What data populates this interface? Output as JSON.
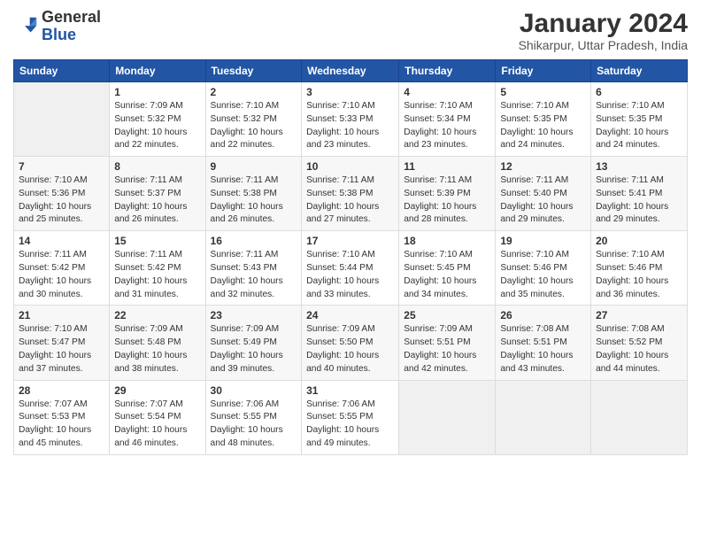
{
  "header": {
    "logo_general": "General",
    "logo_blue": "Blue",
    "title": "January 2024",
    "location": "Shikarpur, Uttar Pradesh, India"
  },
  "days_of_week": [
    "Sunday",
    "Monday",
    "Tuesday",
    "Wednesday",
    "Thursday",
    "Friday",
    "Saturday"
  ],
  "weeks": [
    [
      {
        "day": "",
        "info": ""
      },
      {
        "day": "1",
        "info": "Sunrise: 7:09 AM\nSunset: 5:32 PM\nDaylight: 10 hours\nand 22 minutes."
      },
      {
        "day": "2",
        "info": "Sunrise: 7:10 AM\nSunset: 5:32 PM\nDaylight: 10 hours\nand 22 minutes."
      },
      {
        "day": "3",
        "info": "Sunrise: 7:10 AM\nSunset: 5:33 PM\nDaylight: 10 hours\nand 23 minutes."
      },
      {
        "day": "4",
        "info": "Sunrise: 7:10 AM\nSunset: 5:34 PM\nDaylight: 10 hours\nand 23 minutes."
      },
      {
        "day": "5",
        "info": "Sunrise: 7:10 AM\nSunset: 5:35 PM\nDaylight: 10 hours\nand 24 minutes."
      },
      {
        "day": "6",
        "info": "Sunrise: 7:10 AM\nSunset: 5:35 PM\nDaylight: 10 hours\nand 24 minutes."
      }
    ],
    [
      {
        "day": "7",
        "info": "Sunrise: 7:10 AM\nSunset: 5:36 PM\nDaylight: 10 hours\nand 25 minutes."
      },
      {
        "day": "8",
        "info": "Sunrise: 7:11 AM\nSunset: 5:37 PM\nDaylight: 10 hours\nand 26 minutes."
      },
      {
        "day": "9",
        "info": "Sunrise: 7:11 AM\nSunset: 5:38 PM\nDaylight: 10 hours\nand 26 minutes."
      },
      {
        "day": "10",
        "info": "Sunrise: 7:11 AM\nSunset: 5:38 PM\nDaylight: 10 hours\nand 27 minutes."
      },
      {
        "day": "11",
        "info": "Sunrise: 7:11 AM\nSunset: 5:39 PM\nDaylight: 10 hours\nand 28 minutes."
      },
      {
        "day": "12",
        "info": "Sunrise: 7:11 AM\nSunset: 5:40 PM\nDaylight: 10 hours\nand 29 minutes."
      },
      {
        "day": "13",
        "info": "Sunrise: 7:11 AM\nSunset: 5:41 PM\nDaylight: 10 hours\nand 29 minutes."
      }
    ],
    [
      {
        "day": "14",
        "info": "Sunrise: 7:11 AM\nSunset: 5:42 PM\nDaylight: 10 hours\nand 30 minutes."
      },
      {
        "day": "15",
        "info": "Sunrise: 7:11 AM\nSunset: 5:42 PM\nDaylight: 10 hours\nand 31 minutes."
      },
      {
        "day": "16",
        "info": "Sunrise: 7:11 AM\nSunset: 5:43 PM\nDaylight: 10 hours\nand 32 minutes."
      },
      {
        "day": "17",
        "info": "Sunrise: 7:10 AM\nSunset: 5:44 PM\nDaylight: 10 hours\nand 33 minutes."
      },
      {
        "day": "18",
        "info": "Sunrise: 7:10 AM\nSunset: 5:45 PM\nDaylight: 10 hours\nand 34 minutes."
      },
      {
        "day": "19",
        "info": "Sunrise: 7:10 AM\nSunset: 5:46 PM\nDaylight: 10 hours\nand 35 minutes."
      },
      {
        "day": "20",
        "info": "Sunrise: 7:10 AM\nSunset: 5:46 PM\nDaylight: 10 hours\nand 36 minutes."
      }
    ],
    [
      {
        "day": "21",
        "info": "Sunrise: 7:10 AM\nSunset: 5:47 PM\nDaylight: 10 hours\nand 37 minutes."
      },
      {
        "day": "22",
        "info": "Sunrise: 7:09 AM\nSunset: 5:48 PM\nDaylight: 10 hours\nand 38 minutes."
      },
      {
        "day": "23",
        "info": "Sunrise: 7:09 AM\nSunset: 5:49 PM\nDaylight: 10 hours\nand 39 minutes."
      },
      {
        "day": "24",
        "info": "Sunrise: 7:09 AM\nSunset: 5:50 PM\nDaylight: 10 hours\nand 40 minutes."
      },
      {
        "day": "25",
        "info": "Sunrise: 7:09 AM\nSunset: 5:51 PM\nDaylight: 10 hours\nand 42 minutes."
      },
      {
        "day": "26",
        "info": "Sunrise: 7:08 AM\nSunset: 5:51 PM\nDaylight: 10 hours\nand 43 minutes."
      },
      {
        "day": "27",
        "info": "Sunrise: 7:08 AM\nSunset: 5:52 PM\nDaylight: 10 hours\nand 44 minutes."
      }
    ],
    [
      {
        "day": "28",
        "info": "Sunrise: 7:07 AM\nSunset: 5:53 PM\nDaylight: 10 hours\nand 45 minutes."
      },
      {
        "day": "29",
        "info": "Sunrise: 7:07 AM\nSunset: 5:54 PM\nDaylight: 10 hours\nand 46 minutes."
      },
      {
        "day": "30",
        "info": "Sunrise: 7:06 AM\nSunset: 5:55 PM\nDaylight: 10 hours\nand 48 minutes."
      },
      {
        "day": "31",
        "info": "Sunrise: 7:06 AM\nSunset: 5:55 PM\nDaylight: 10 hours\nand 49 minutes."
      },
      {
        "day": "",
        "info": ""
      },
      {
        "day": "",
        "info": ""
      },
      {
        "day": "",
        "info": ""
      }
    ]
  ]
}
